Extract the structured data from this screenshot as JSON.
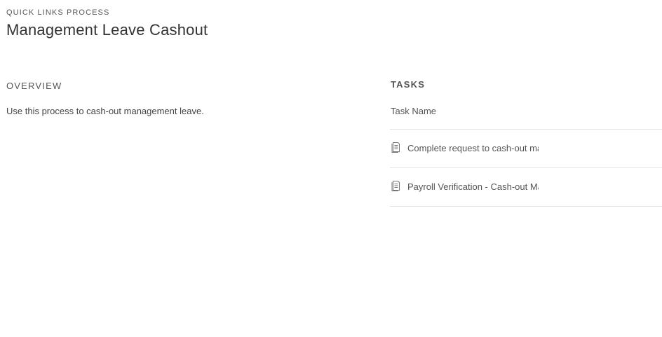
{
  "header": {
    "eyebrow": "QUICK LINKS PROCESS",
    "title": "Management Leave Cashout"
  },
  "overview": {
    "heading": "OVERVIEW",
    "text": "Use this process to cash-out management leave."
  },
  "tasks": {
    "heading": "TASKS",
    "column_header": "Task Name",
    "items": [
      {
        "label": "Complete request to cash-out management leave",
        "icon": "document-icon"
      },
      {
        "label": "Payroll Verification - Cash-out Management Leave",
        "icon": "document-icon"
      }
    ]
  }
}
